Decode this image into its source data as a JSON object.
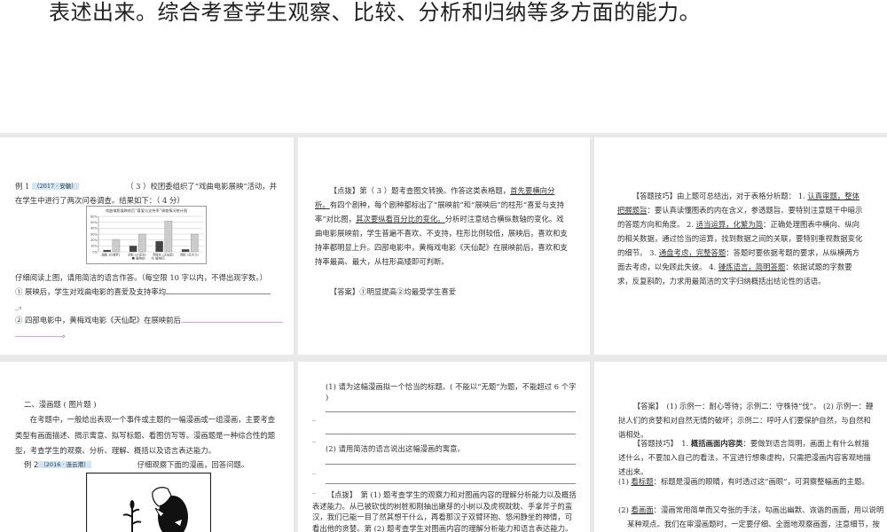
{
  "top_slide": {
    "text": "表述出来。综合考查学生观察、比较、分析和归纳等多方面的能力。"
  },
  "slide1": {
    "example_label": "例 1",
    "tag": "（2017 · 安徽）",
    "question": "（ 3 ）校团委组织了“戏曲电影展映”活动，并在学生中进行了两次问卷调查。结果如下：（ 4 分）",
    "instruction": "仔细阅读上图，请用简洁的语言作答。（每空限 10 字以内，不得出现字数。）",
    "q1": "① 展映后，学生对戏曲电影的喜爱及支持率均",
    "q1_end": "_。",
    "q2": "② 四部电影中，黄梅戏电影《天仙配》在展映前后",
    "q2_end": "。"
  },
  "chart_data": {
    "type": "bar",
    "title": "戏曲电影展映前后“喜爱与支持率”调查情况统计图",
    "categories": [
      "越剧《红楼梦》",
      "京剧《沙家浜》",
      "黄梅戏《天仙配》",
      "豫剧《花木兰》"
    ],
    "series": [
      {
        "name": "展映前",
        "values": [
          3,
          10,
          18,
          4
        ],
        "color": "#444444"
      },
      {
        "name": "展映后",
        "values": [
          21,
          30,
          52,
          30
        ],
        "color": "#cccccc"
      }
    ],
    "ylim": [
      0,
      60
    ],
    "yticks": [
      "0%",
      "10%",
      "20%",
      "30%",
      "40%",
      "50%",
      "60%"
    ],
    "legend": "bottom",
    "grid": true
  },
  "slide2": {
    "p1_a": "【点拨】第（ 3 ）题考查图文转换。作答这类表格题，",
    "p1_u1": "首先要横向分析。",
    "p1_b": "有四个剧种，每个剧种都标出了“展映前”和“展映后”的柱形“喜爱与支持率”对比图，",
    "p1_u2": "其次要纵看百分比的变化。",
    "p1_c": "分析时注意结合横纵数轴的变化。戏曲电影展映前，学生普遍不喜欢、不支持，柱形比例较低，展映后，喜欢和支持率都明显上升。四部电影中，黄梅戏电影《天仙配》在展映前后，喜欢和支持率最高、最大，从柱形高矮即可判断。",
    "answer": "【答案】①明显提高②均最受学生喜爱"
  },
  "slide3": {
    "a": "【答题技巧】由上题可总结出，对于表格分析题： 1. ",
    "u1": "认真审题，整体把握题旨",
    "b": "：要认真读懂图表的内在含义，参透题旨。要特别注意题干中暗示的答题方向和角度。 2. ",
    "u2": "适当运算，化繁为简",
    "c": "：正确处理图表中横向、纵向的相关数据，通过恰当的运算，找到数据之间的关联，要特别重视数据变化的细节。 3. ",
    "u3": "通盘考虑，完整答题",
    "d": "：答题时要依据考题的要求，从纵横两方面去考虑，以免顾此失彼。 4. ",
    "u4": "锤炼语言，简明答题",
    "e": "：依据试题的字数要求，反复斟酌，力求用最简洁的文字归纳概括出结论性的话语。"
  },
  "slide4": {
    "heading": "二、漫画题 ( 图片题 )",
    "intro": "在考题中，一般给出表现一个事件或主题的一幅漫画或一组漫画，主要考查类型有画面描述、揭示寓意、拟写标题、看图仿写等。漫画题是一种综合性的题型，考查学生的观察、分析、理解、概括以及语言表达能力。",
    "example_label": "例 2",
    "tag": "（2016 · 连云港）",
    "prompt": "仔细观察下面的漫画，回答问题。"
  },
  "slide5": {
    "q1": "(1) 请为这幅漫画拟一个恰当的标题。( 不能以“无题”为题，不能超过 6 个字 )",
    "q2": "(2) 请用简洁的语言说出这幅漫画的寓意。",
    "dash": "_",
    "hint": "【点拨】　第 (1) 题考查学生的观察力和对图画内容的理解分析能力以及概括表述能力。从已被砍伐的树桩和刚抽出嫩芽的小树以及虎视眈眈、手拿斧子的蛮汉，我们已能一目了然其想干什么，再看那汉子双臂环抱、悠闲静坐的神情，可看出他的贪婪。第 (2) 题考查学生对图画内容的理解分析能力和语言表达能力。"
  },
  "slide6": {
    "answer": "【答案】　(1) 示例一：耐心等待；示例二：守株待“伐”。 (2) 示例一：鞭挞人们的贪婪和对自然无情的破坏；示例二：呼吁人们要保护自然，与自然和谐相处。",
    "tip_a": "【答题技巧】　1. ",
    "tip_bold": "概括画面内容类",
    "tip_b": "：要做到语言简明，画面上有什么就描述什么，不要加入自己的看法，不宜进行想象虚构，只需把漫画内容客观地描述出来。",
    "item1_num": "(1) ",
    "item1_u": "看标题",
    "item1": "：标题是漫画的眼睛，有时透过这“画眼”，可洞察整幅画的主题。",
    "item2_num": "(2) ",
    "item2_u": "看画面",
    "item2": "：漫画常用简单而又夸张的手法，勾画出幽默、诙谐的画面，用以说明某种观点。我们在审漫画题时，一定要仔细、全面地观察画面，注意细节，按照一定的顺序描述，揭示画面背后的深层寓意。"
  }
}
